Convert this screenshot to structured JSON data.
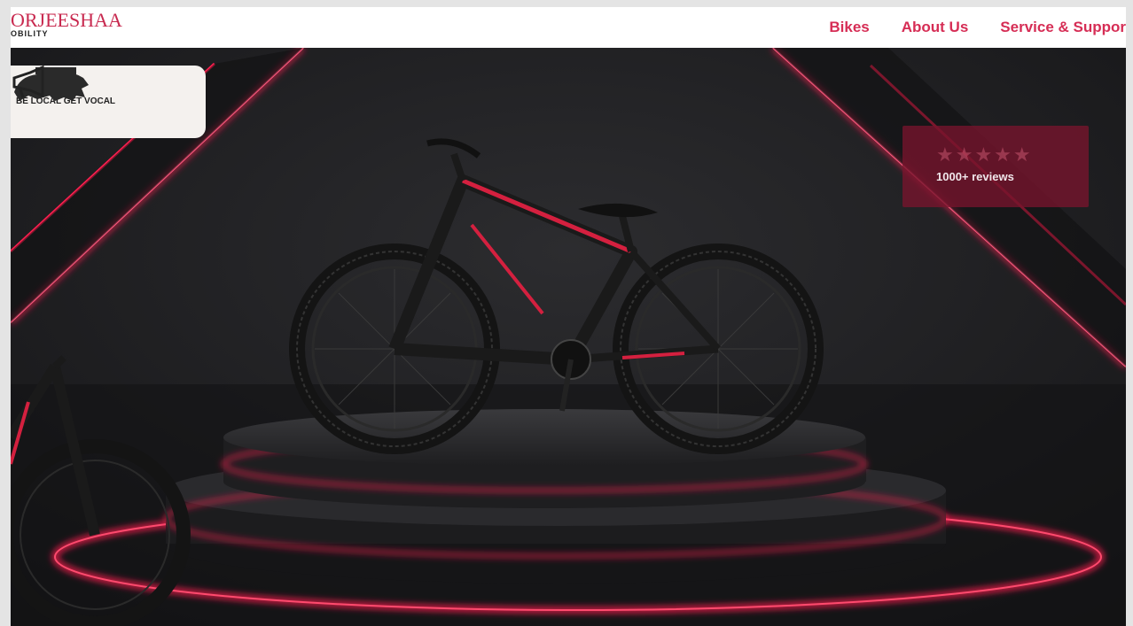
{
  "header": {
    "logo_main": "ORJEESHAA",
    "logo_sub": "OBILITY",
    "nav": [
      "Bikes",
      "About Us",
      "Service & Suppor"
    ]
  },
  "hero": {
    "badge_text": "BE LOCAL GET VOCAL",
    "rating": {
      "stars": "★★★★★",
      "value": 5,
      "max": 5,
      "reviews": "1000+ reviews"
    }
  },
  "colors": {
    "brand": "#d62d55",
    "neon": "#ff1f4f",
    "background": "#1a1a1c"
  }
}
